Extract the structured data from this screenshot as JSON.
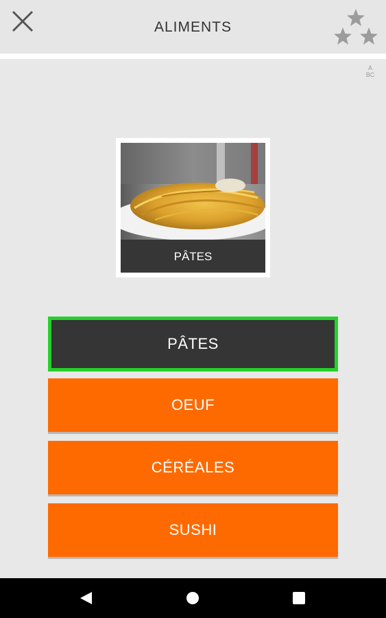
{
  "header": {
    "title": "ALIMENTS",
    "close_icon": "close-icon",
    "stars_icon": "stars-icon",
    "abc_top": "A",
    "abc_bottom": "BC"
  },
  "card": {
    "image": "pasta-photo",
    "caption": "PÂTES"
  },
  "answers": [
    {
      "label": "PÂTES",
      "state": "correct"
    },
    {
      "label": "OEUF",
      "state": "option"
    },
    {
      "label": "CÉRÉALES",
      "state": "option"
    },
    {
      "label": "SUSHI",
      "state": "option"
    }
  ],
  "colors": {
    "accent": "#ff6a00",
    "correct_border": "#25d02a",
    "selected_bg": "#353535",
    "background": "#e8e8e8"
  },
  "navbar": {
    "back_icon": "back-icon",
    "home_icon": "home-icon",
    "recent_icon": "recent-apps-icon"
  }
}
